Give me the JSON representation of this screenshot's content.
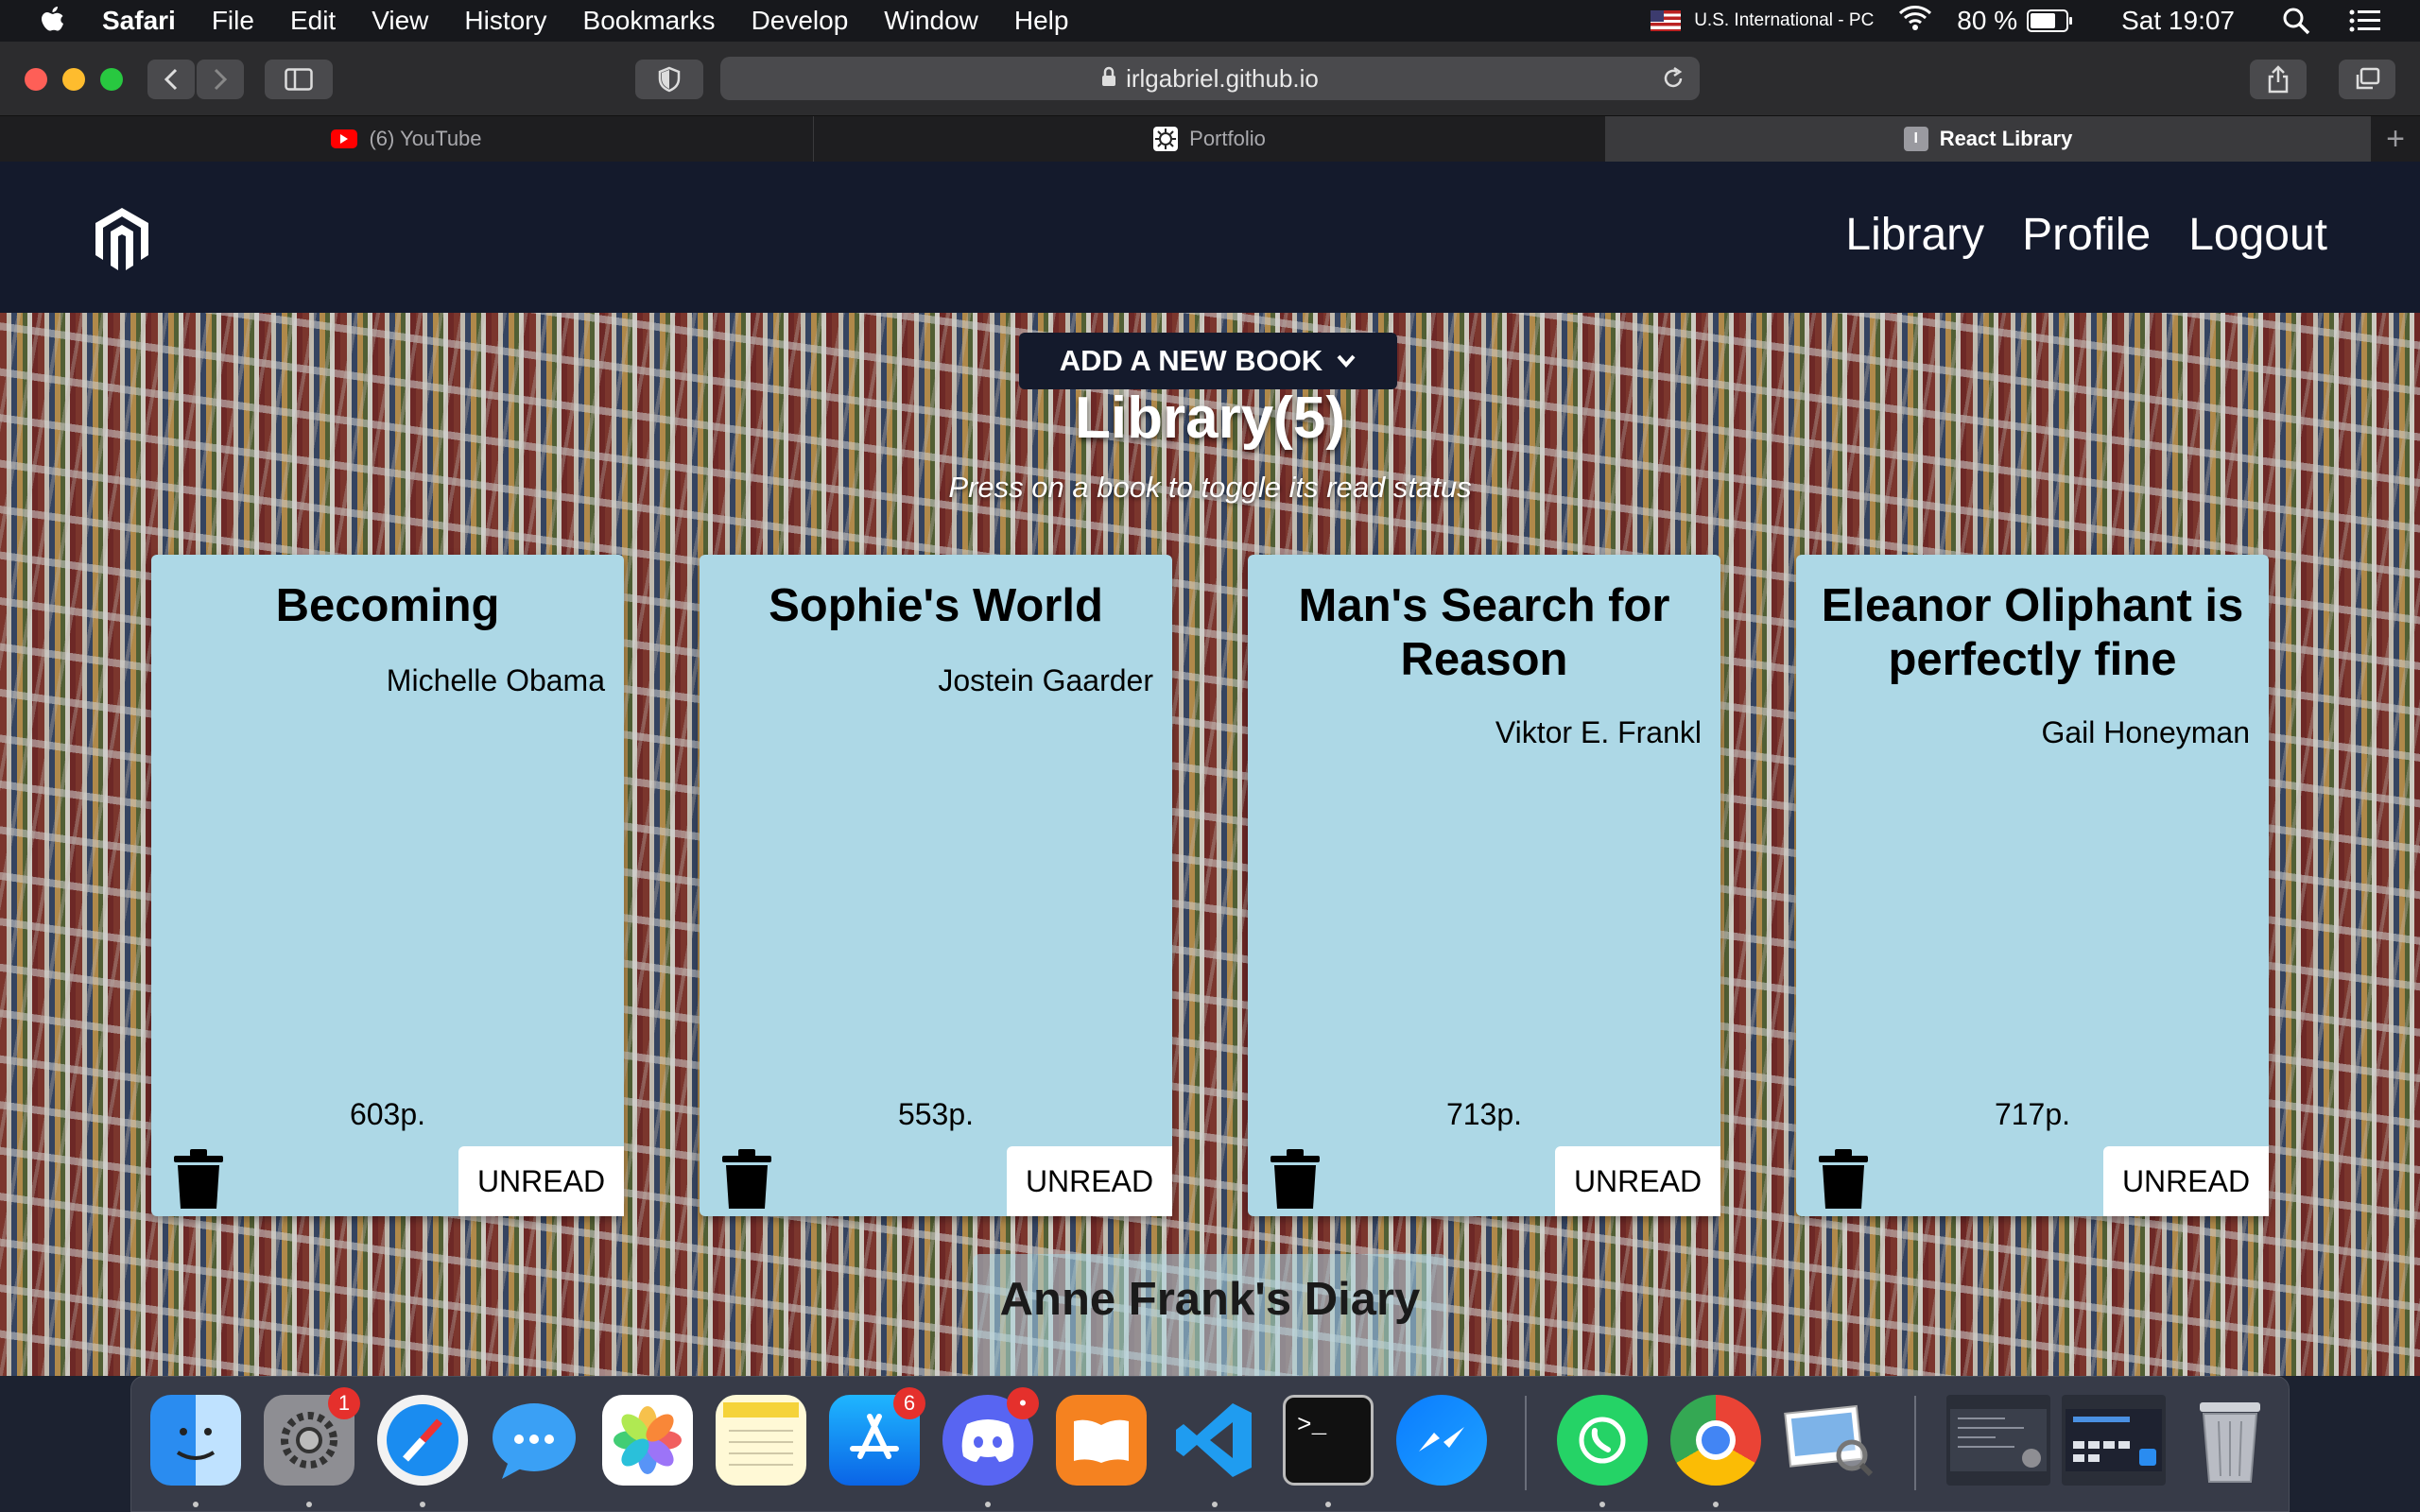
{
  "menubar": {
    "app": "Safari",
    "items": [
      "File",
      "Edit",
      "View",
      "History",
      "Bookmarks",
      "Develop",
      "Window",
      "Help"
    ],
    "keyboard": "U.S. International - PC",
    "battery": "80 %",
    "battery_level": 0.8,
    "clock": "Sat 19:07"
  },
  "toolbar": {
    "url": "irlgabriel.github.io"
  },
  "tabs": [
    {
      "label": "(6) YouTube",
      "icon": "youtube-icon"
    },
    {
      "label": "Portfolio",
      "icon": "portfolio-favicon"
    },
    {
      "label": "React Library",
      "icon": "react-library-favicon",
      "favicon_letter": "I"
    }
  ],
  "site": {
    "nav": [
      "Library",
      "Profile",
      "Logout"
    ],
    "add_button": "ADD A NEW BOOK",
    "title": "Library(5)",
    "subtitle": "Press on a book to toggle its read status",
    "books": [
      {
        "title": "Becoming",
        "author": "Michelle Obama",
        "pages": "603p.",
        "status": "UNREAD"
      },
      {
        "title": "Sophie's World",
        "author": "Jostein Gaarder",
        "pages": "553p.",
        "status": "UNREAD"
      },
      {
        "title": "Man's Search for Reason",
        "author": "Viktor E. Frankl",
        "pages": "713p.",
        "status": "UNREAD"
      },
      {
        "title": "Eleanor Oliphant is perfectly fine",
        "author": "Gail Honeyman",
        "pages": "717p.",
        "status": "UNREAD"
      }
    ],
    "peek_book": {
      "title": "Anne Frank's Diary"
    }
  },
  "dock": {
    "apps": [
      {
        "name": "finder-icon"
      },
      {
        "name": "system-preferences-icon",
        "badge": "1"
      },
      {
        "name": "safari-icon"
      },
      {
        "name": "messages-icon"
      },
      {
        "name": "photos-icon"
      },
      {
        "name": "notes-icon"
      },
      {
        "name": "app-store-icon",
        "badge": "6"
      },
      {
        "name": "discord-icon",
        "badge": "•"
      },
      {
        "name": "books-icon"
      },
      {
        "name": "vscode-icon"
      },
      {
        "name": "terminal-icon",
        "glyph": ">_"
      },
      {
        "name": "messenger-icon"
      },
      {
        "name": "whatsapp-icon"
      },
      {
        "name": "chrome-icon"
      },
      {
        "name": "preview-icon"
      },
      {
        "name": "window-thumbnail-1"
      },
      {
        "name": "window-thumbnail-2"
      },
      {
        "name": "trash-icon"
      }
    ]
  },
  "colors": {
    "header_bg": "#141a2c",
    "card_bg": "#add8e6",
    "menubar_bg": "#17181c"
  }
}
